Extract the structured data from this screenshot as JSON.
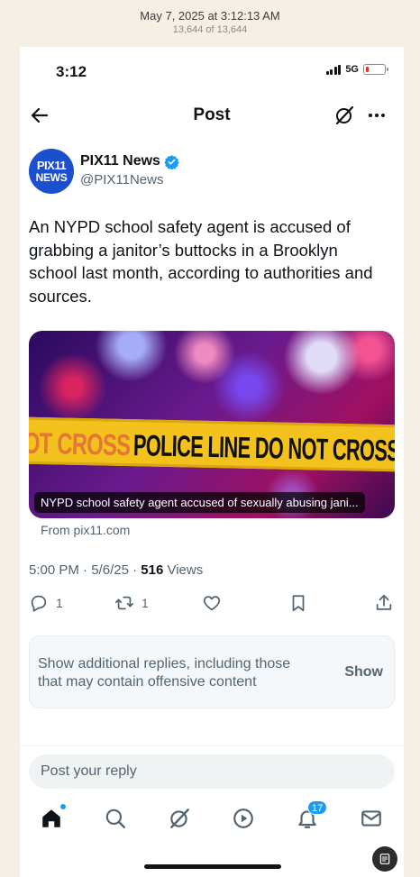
{
  "screenshot_banner": {
    "date": "May 7, 2025 at 3:12:13 AM",
    "count": "13,644 of 13,644"
  },
  "status_bar": {
    "time": "3:12",
    "network": "5G",
    "battery_level": 0.15,
    "battery_color": "#e0322b"
  },
  "header": {
    "title": "Post",
    "back_icon": "back-arrow-icon",
    "grok_icon": "grok-icon",
    "more_icon": "more-horizontal-icon"
  },
  "author": {
    "avatar_line1": "PIX11",
    "avatar_line2": "NEWS",
    "name": "PIX11 News",
    "handle": "@PIX11News",
    "verified": true,
    "verified_color": "#1d9bf0"
  },
  "tweet": {
    "text": "An NYPD school safety agent is accused of grabbing a janitor’s buttocks in a Brooklyn school last month, according to authorities and sources."
  },
  "media": {
    "tape_faded_text": "OT CROSS",
    "tape_main_text": "POLICE LINE DO NOT CROSS",
    "caption": "NYPD school safety agent accused of sexually abusing jani...",
    "source": "From pix11.com"
  },
  "meta": {
    "time": "5:00 PM",
    "date": "5/6/25",
    "views_count": "516",
    "views_label": "Views"
  },
  "actions": {
    "replies": "1",
    "reposts": "1"
  },
  "additional_replies": {
    "text": "Show additional replies, including those that may contain offensive content",
    "button": "Show"
  },
  "reply_bar": {
    "placeholder": "Post your reply"
  },
  "bottom_nav": {
    "notifications_badge": "17",
    "accent_color": "#1d9bf0"
  }
}
